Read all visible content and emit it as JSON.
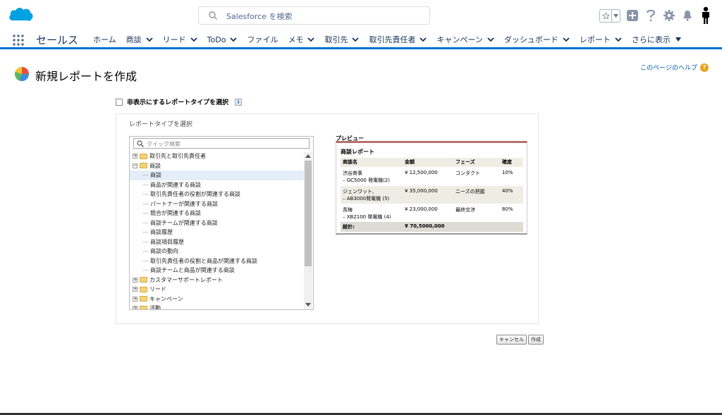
{
  "header": {
    "search_placeholder": "Salesforce を検索"
  },
  "nav": {
    "app_name": "セールス",
    "items": [
      {
        "label": "ホーム",
        "dropdown": false
      },
      {
        "label": "商談",
        "dropdown": true
      },
      {
        "label": "リード",
        "dropdown": true
      },
      {
        "label": "ToDo",
        "dropdown": true
      },
      {
        "label": "ファイル",
        "dropdown": false
      },
      {
        "label": "メモ",
        "dropdown": true
      },
      {
        "label": "取引先",
        "dropdown": true
      },
      {
        "label": "取引先責任者",
        "dropdown": true
      },
      {
        "label": "キャンペーン",
        "dropdown": true
      },
      {
        "label": "ダッシュボード",
        "dropdown": true
      },
      {
        "label": "レポート",
        "dropdown": true
      },
      {
        "label": "さらに表示",
        "dropdown": true
      }
    ]
  },
  "page": {
    "title": "新規レポートを作成",
    "help": "このページのヘルプ",
    "hidden_types_label": "非表示にするレポートタイプを選択",
    "select_type_label": "レポートタイプを選択",
    "quick_search_placeholder": "クイック検索"
  },
  "tree": [
    {
      "type": "folder",
      "expanded": false,
      "label": "取引先と取引先責任者"
    },
    {
      "type": "folder",
      "expanded": true,
      "label": "商談"
    },
    {
      "type": "child",
      "label": "商談",
      "selected": true
    },
    {
      "type": "child",
      "label": "商品が関連する商談"
    },
    {
      "type": "child",
      "label": "取引先責任者の役割が関連する商談"
    },
    {
      "type": "child",
      "label": "パートナーが関連する商談"
    },
    {
      "type": "child",
      "label": "競合が関連する商談"
    },
    {
      "type": "child",
      "label": "商談チームが関連する商談"
    },
    {
      "type": "child",
      "label": "商談履歴"
    },
    {
      "type": "child",
      "label": "商談項目履歴"
    },
    {
      "type": "child",
      "label": "商談の動向"
    },
    {
      "type": "child",
      "label": "取引先責任者の役割と商品が関連する商談"
    },
    {
      "type": "child",
      "label": "商談チームと商品が関連する商談"
    },
    {
      "type": "folder",
      "expanded": false,
      "label": "カスタマーサポートレポート"
    },
    {
      "type": "folder",
      "expanded": false,
      "label": "リード"
    },
    {
      "type": "folder",
      "expanded": false,
      "label": "キャンペーン"
    },
    {
      "type": "folder",
      "expanded": false,
      "label": "活動"
    }
  ],
  "preview": {
    "label": "プレビュー",
    "report_title": "商談レポート",
    "columns": [
      "商談名",
      "金額",
      "フェーズ",
      "確度"
    ],
    "rows": [
      {
        "name": "渋谷商事",
        "sub": "– GC5000 発電機(2)",
        "amount": "¥ 12,500,000",
        "phase": "コンタクト",
        "prob": "10%"
      },
      {
        "name": "ジェンワット,",
        "sub": "– AB3000発電機 (5)",
        "amount": "¥ 35,000,000",
        "phase": "ニーズの把握",
        "prob": "40%"
      },
      {
        "name": "青梅",
        "sub": "– XB2100 発電機 (4)",
        "amount": "¥ 23,000,000",
        "phase": "最終交渉",
        "prob": "80%"
      }
    ],
    "total_label": "総計:",
    "total_amount": "¥ 70,5000,000"
  },
  "buttons": {
    "cancel": "キャンセル",
    "create": "作成"
  },
  "colors": {
    "brand": "#00a1e0",
    "nav_underline": "#0070d2",
    "preview_accent": "#b4716f"
  }
}
